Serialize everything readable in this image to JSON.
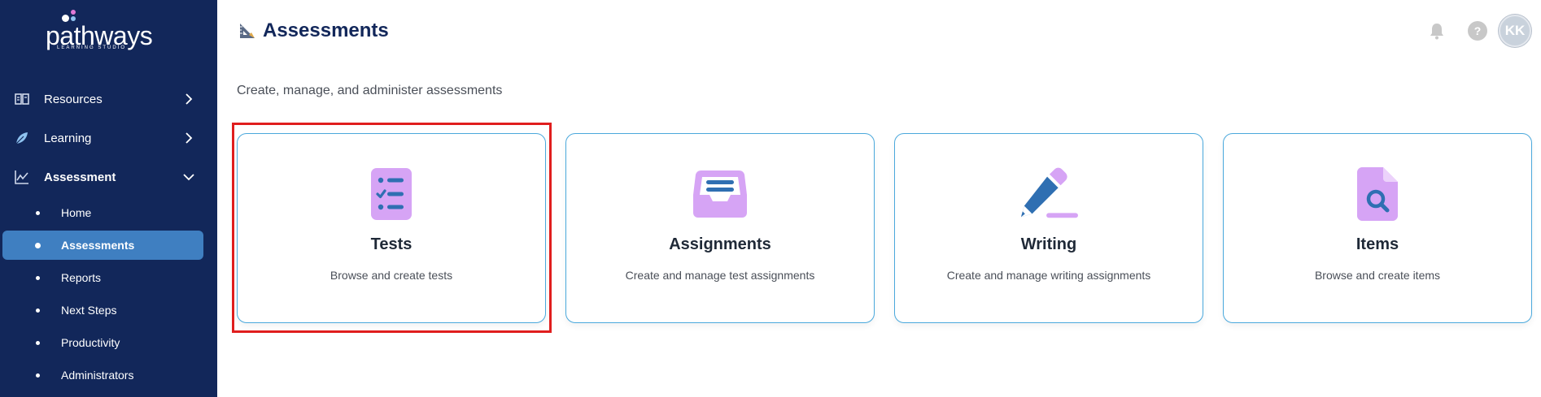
{
  "brand": {
    "logo_text": "pathways",
    "logo_sub": "LEARNING STUDIO"
  },
  "sidebar": {
    "items": [
      {
        "label": "Resources",
        "icon": "book-icon",
        "expanded": false
      },
      {
        "label": "Learning",
        "icon": "leaf-icon",
        "expanded": false
      },
      {
        "label": "Assessment",
        "icon": "chart-line-icon",
        "expanded": true
      }
    ],
    "sub_items": [
      {
        "label": "Home",
        "active": false
      },
      {
        "label": "Assessments",
        "active": true
      },
      {
        "label": "Reports",
        "active": false
      },
      {
        "label": "Next Steps",
        "active": false
      },
      {
        "label": "Productivity",
        "active": false
      },
      {
        "label": "Administrators",
        "active": false
      }
    ]
  },
  "header": {
    "title": "Assessments",
    "title_icon": "ruler-triangle-icon",
    "help_label": "?",
    "avatar_initials": "KK"
  },
  "main": {
    "subtitle": "Create, manage, and administer assessments",
    "cards": [
      {
        "title": "Tests",
        "description": "Browse and create tests",
        "icon": "checklist-icon"
      },
      {
        "title": "Assignments",
        "description": "Create and manage test assignments",
        "icon": "inbox-tray-icon"
      },
      {
        "title": "Writing",
        "description": "Create and manage writing assignments",
        "icon": "pencil-icon"
      },
      {
        "title": "Items",
        "description": "Browse and create items",
        "icon": "file-search-icon"
      }
    ]
  },
  "colors": {
    "sidebar_bg": "#12275a",
    "active_item_bg": "#3f7fc1",
    "card_border": "#4aa8dc",
    "icon_purple": "#d6a4f5",
    "icon_blue": "#2f6fb2",
    "highlight": "#e01e1e"
  }
}
